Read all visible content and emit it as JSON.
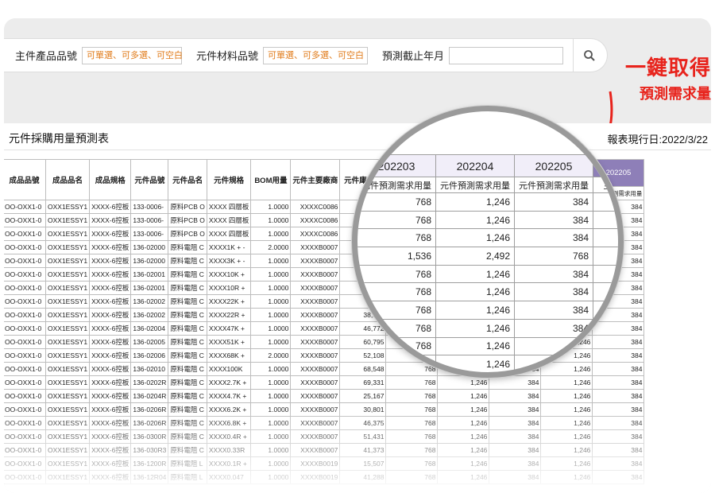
{
  "search": {
    "main_part_label": "主件產品品號",
    "main_part_placeholder": "可單選、可多選、可空白",
    "material_label": "元件材料品號",
    "material_placeholder": "可單選、可多選、可空白",
    "cutoff_label": "預測截止年月",
    "cutoff_value": ""
  },
  "callout": {
    "line1": "一鍵取得",
    "line2": "預測需求量"
  },
  "colors": {
    "accent_red": "#e8231c",
    "header_purple": "#8e7fb8",
    "placeholder_orange": "#e07b1a"
  },
  "sheet": {
    "title": "元件採購用量預測表",
    "date_label": "報表現行日:2022/3/22",
    "columns": [
      "成品品號",
      "成品品名",
      "成品規格",
      "元件品號",
      "元件品名",
      "元件規格",
      "BOM用量",
      "元件主要廠商",
      "元件庫存量"
    ],
    "month_columns": [
      "202203",
      "202204",
      "202205",
      "202204",
      "202205"
    ],
    "sub_header": [
      "元件預測需求用量",
      "元件預測需求用量",
      "元件預測需求用量",
      "主件預測需求用量",
      "主件預測需求用量"
    ],
    "rows": [
      [
        "OO-OXX1-0",
        "OXX1ESSY1",
        "XXXX-6控板",
        "133-0006-",
        "原料PCB O",
        "XXXX 四層板",
        "1.0000",
        "XXXXC0086",
        "0",
        "768",
        "1,246",
        "384",
        "1,246",
        "384"
      ],
      [
        "OO-OXX1-0",
        "OXX1ESSY1",
        "XXXX-6控板",
        "133-0006-",
        "原料PCB O",
        "XXXX 四層板",
        "1.0000",
        "XXXXC0086",
        "0",
        "768",
        "1,246",
        "384",
        "1,246",
        "384"
      ],
      [
        "OO-OXX1-0",
        "OXX1ESSY1",
        "XXXX-6控板",
        "133-0006-",
        "原料PCB O",
        "XXXX 四層板",
        "1.0000",
        "XXXXC0086",
        "0",
        "768",
        "1,246",
        "384",
        "1,246",
        "384"
      ],
      [
        "OO-OXX1-0",
        "OXX1ESSY1",
        "XXXX-6控板",
        "136-02000",
        "原料電阻 C",
        "XXXX1K + -",
        "2.0000",
        "XXXXB0007",
        "117,7",
        "1,536",
        "2,492",
        "768",
        "1,246",
        "384"
      ],
      [
        "OO-OXX1-0",
        "OXX1ESSY1",
        "XXXX-6控板",
        "136-02000",
        "原料電阻 C",
        "XXXX3K + -",
        "1.0000",
        "XXXXB0007",
        "26,3",
        "768",
        "1,246",
        "384",
        "1,246",
        "384"
      ],
      [
        "OO-OXX1-0",
        "OXX1ESSY1",
        "XXXX-6控板",
        "136-02001",
        "原料電阻 C",
        "XXXX10K +",
        "1.0000",
        "XXXXB0007",
        "306,8",
        "768",
        "1,246",
        "384",
        "1,246",
        "384"
      ],
      [
        "OO-OXX1-0",
        "OXX1ESSY1",
        "XXXX-6控板",
        "136-02001",
        "原料電阻 C",
        "XXXX10R +",
        "1.0000",
        "XXXXB0007",
        "",
        "768",
        "1,246",
        "384",
        "1,246",
        "384"
      ],
      [
        "OO-OXX1-0",
        "OXX1ESSY1",
        "XXXX-6控板",
        "136-02002",
        "原料電阻 C",
        "XXXX22K +",
        "1.0000",
        "XXXXB0007",
        "0",
        "768",
        "1,246",
        "384",
        "1,246",
        "384"
      ],
      [
        "OO-OXX1-0",
        "OXX1ESSY1",
        "XXXX-6控板",
        "136-02002",
        "原料電阻 C",
        "XXXX22R +",
        "1.0000",
        "XXXXB0007",
        "38,838",
        "768",
        "1,246",
        "384",
        "1,246",
        "384"
      ],
      [
        "OO-OXX1-0",
        "OXX1ESSY1",
        "XXXX-6控板",
        "136-02004",
        "原料電阻 C",
        "XXXX47K +",
        "1.0000",
        "XXXXB0007",
        "46,772",
        "768",
        "1,246",
        "384",
        "1,246",
        "384"
      ],
      [
        "OO-OXX1-0",
        "OXX1ESSY1",
        "XXXX-6控板",
        "136-02005",
        "原料電阻 C",
        "XXXX51K +",
        "1.0000",
        "XXXXB0007",
        "60,795",
        "768",
        "1,246",
        "384",
        "1,246",
        "384"
      ],
      [
        "OO-OXX1-0",
        "OXX1ESSY1",
        "XXXX-6控板",
        "136-02006",
        "原料電阻 C",
        "XXXX68K +",
        "2.0000",
        "XXXXB0007",
        "52,108",
        "768",
        "1,246",
        "384",
        "1,246",
        "384"
      ],
      [
        "OO-OXX1-0",
        "OXX1ESSY1",
        "XXXX-6控板",
        "136-02010",
        "原料電阻 C",
        "XXXX100K",
        "1.0000",
        "XXXXB0007",
        "68,548",
        "768",
        "1,246",
        "384",
        "1,246",
        "384"
      ],
      [
        "OO-OXX1-0",
        "OXX1ESSY1",
        "XXXX-6控板",
        "136-0202R",
        "原料電阻 C",
        "XXXX2.7K +",
        "1.0000",
        "XXXXB0007",
        "69,331",
        "768",
        "1,246",
        "384",
        "1,246",
        "384"
      ],
      [
        "OO-OXX1-0",
        "OXX1ESSY1",
        "XXXX-6控板",
        "136-0204R",
        "原料電阻 C",
        "XXXX4.7K +",
        "1.0000",
        "XXXXB0007",
        "25,167",
        "768",
        "1,246",
        "384",
        "1,246",
        "384"
      ],
      [
        "OO-OXX1-0",
        "OXX1ESSY1",
        "XXXX-6控板",
        "136-0206R",
        "原料電阻 C",
        "XXXX6.2K +",
        "1.0000",
        "XXXXB0007",
        "30,801",
        "768",
        "1,246",
        "384",
        "1,246",
        "384"
      ],
      [
        "OO-OXX1-0",
        "OXX1ESSY1",
        "XXXX-6控板",
        "136-0206R",
        "原料電阻 C",
        "XXXX6.8K +",
        "1.0000",
        "XXXXB0007",
        "46,375",
        "768",
        "1,246",
        "384",
        "1,246",
        "384"
      ],
      [
        "OO-OXX1-0",
        "OXX1ESSY1",
        "XXXX-6控板",
        "136-0300R",
        "原料電阻 C",
        "XXXX0.4R +",
        "1.0000",
        "XXXXB0007",
        "51,431",
        "768",
        "1,246",
        "384",
        "1,246",
        "384"
      ],
      [
        "OO-OXX1-0",
        "OXX1ESSY1",
        "XXXX-6控板",
        "136-030R3",
        "原料電阻 C",
        "XXXX0.33R",
        "1.0000",
        "XXXXB0007",
        "41,373",
        "768",
        "1,246",
        "384",
        "1,246",
        "384"
      ],
      [
        "OO-OXX1-0",
        "OXX1ESSY1",
        "XXXX-6控板",
        "136-1200R",
        "原料電阻 L",
        "XXXX0.1R +",
        "1.0000",
        "XXXXB0019",
        "15,507",
        "768",
        "1,246",
        "384",
        "1,246",
        "384"
      ],
      [
        "OO-OXX1-0",
        "OXX1ESSY1",
        "XXXX-6控板",
        "136-12R04",
        "原料電阻 L",
        "XXXX0.047",
        "1.0000",
        "XXXXB0019",
        "41,288",
        "768",
        "1,246",
        "384",
        "1,246",
        "384"
      ]
    ]
  },
  "zoom": {
    "months": [
      "202203",
      "202204",
      "202205"
    ],
    "side_months": [
      "202204"
    ],
    "sub_header": "元件預測需求用量",
    "side_sub": "主件",
    "rows": [
      [
        "768",
        "1,246",
        "384"
      ],
      [
        "768",
        "1,246",
        "384"
      ],
      [
        "768",
        "1,246",
        "384"
      ],
      [
        "1,536",
        "2,492",
        "768"
      ],
      [
        "768",
        "1,246",
        "384"
      ],
      [
        "768",
        "1,246",
        "384"
      ],
      [
        "768",
        "1,246",
        "384"
      ],
      [
        "768",
        "1,246",
        "384"
      ],
      [
        "768",
        "1,246",
        "384"
      ],
      [
        "",
        "1,246",
        "384"
      ]
    ]
  }
}
